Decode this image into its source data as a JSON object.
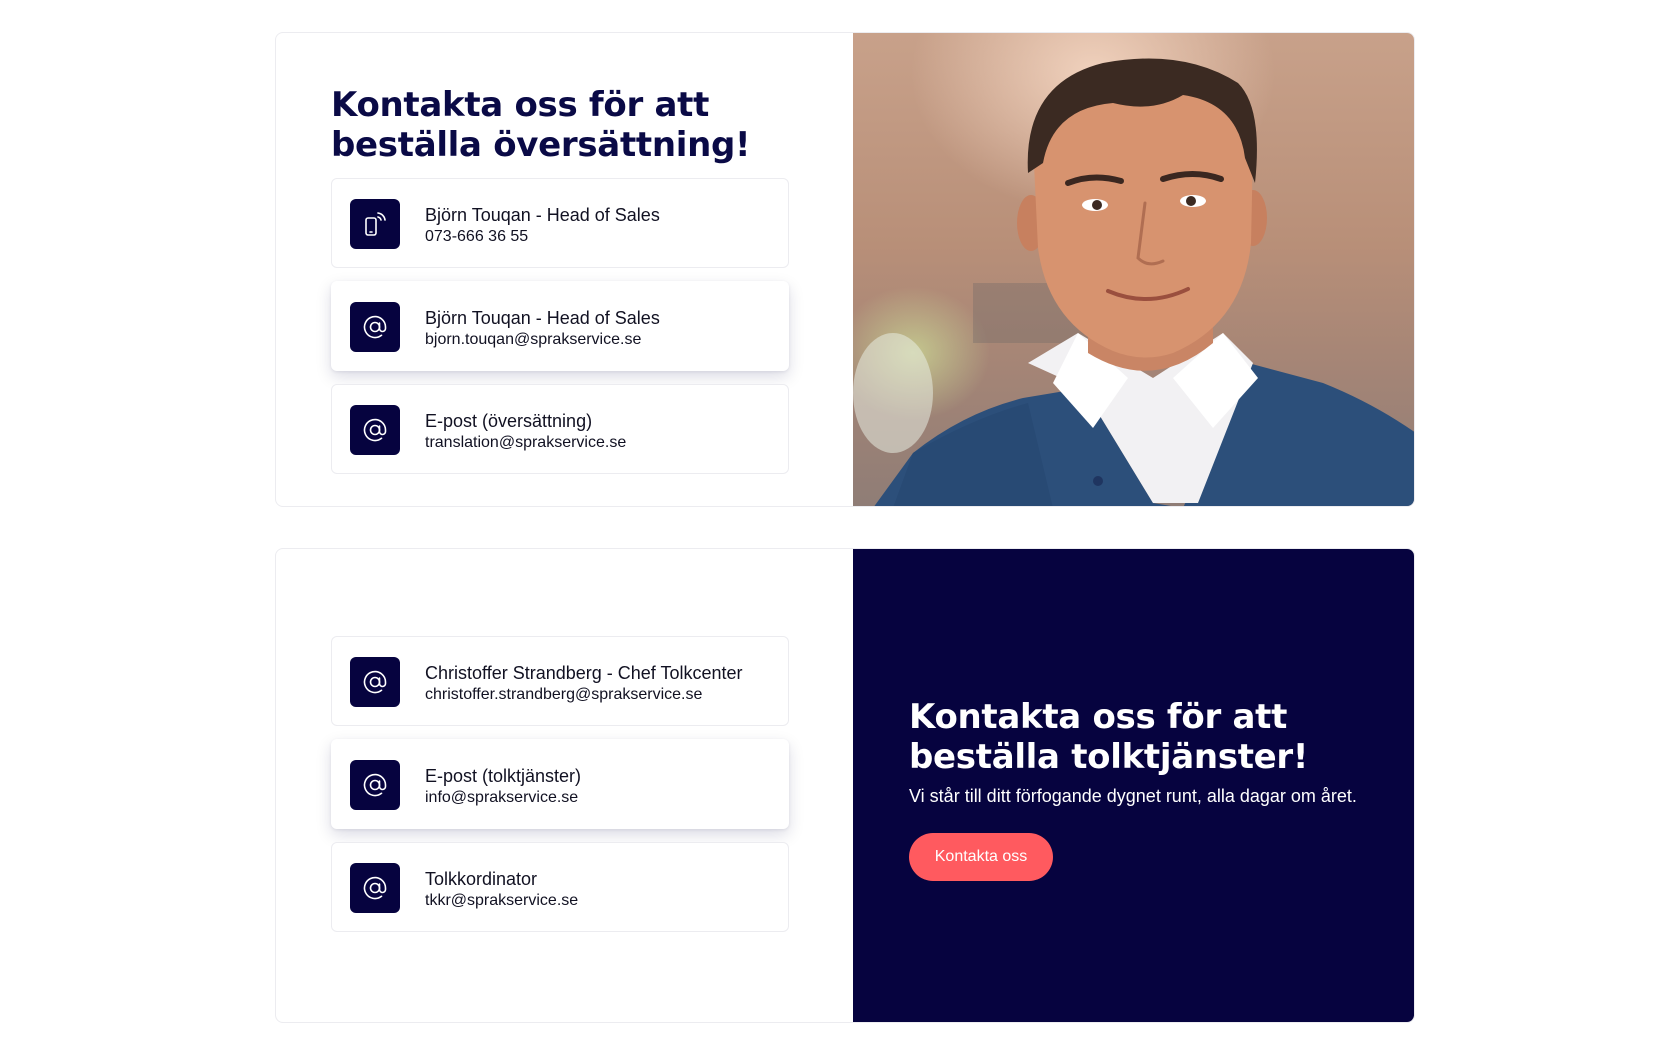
{
  "translation_section": {
    "heading": "Kontakta oss för att beställa översättning!",
    "contacts": [
      {
        "icon": "phone-icon",
        "title": "Björn Touqan - Head of Sales",
        "detail": "073-666 36 55"
      },
      {
        "icon": "at-sign-icon",
        "title": "Björn Touqan - Head of Sales",
        "detail": "bjorn.touqan@sprakservice.se"
      },
      {
        "icon": "at-sign-icon",
        "title": "E-post (översättning)",
        "detail": "translation@sprakservice.se"
      }
    ],
    "photo": "portrait-photo"
  },
  "interpreting_section": {
    "contacts": [
      {
        "icon": "at-sign-icon",
        "title": "Christoffer Strandberg - Chef Tolkcenter",
        "detail": "christoffer.strandberg@sprakservice.se"
      },
      {
        "icon": "at-sign-icon",
        "title": "E-post (tolktjänster)",
        "detail": "info@sprakservice.se"
      },
      {
        "icon": "at-sign-icon",
        "title": "Tolkkordinator",
        "detail": "tkkr@sprakservice.se"
      }
    ],
    "heading": "Kontakta oss för att beställa tolktjänster!",
    "text": "Vi står till ditt förfogande dygnet runt, alla dagar om året.",
    "button_label": "Kontakta oss"
  },
  "colors": {
    "navy": "#06033f",
    "coral": "#ff5a5f",
    "heading": "#0a0a46"
  }
}
